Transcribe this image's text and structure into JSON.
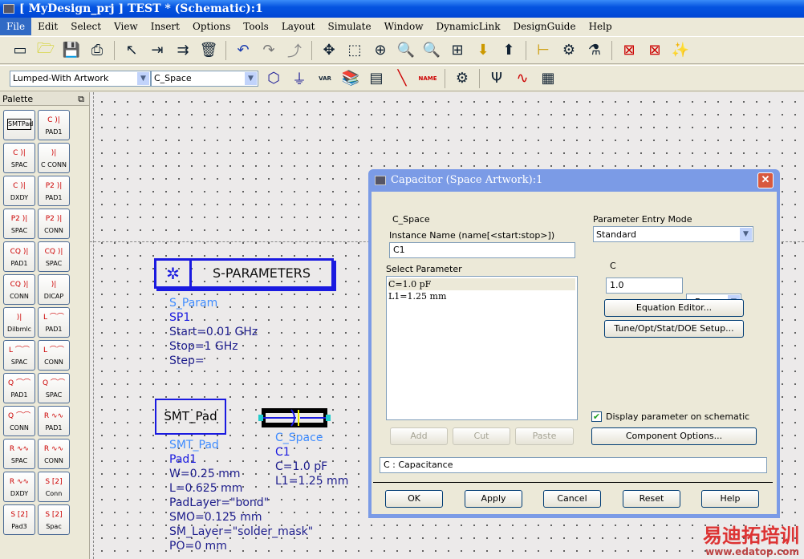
{
  "window": {
    "title": "[ MyDesign_prj ] TEST * (Schematic):1"
  },
  "menu": [
    "File",
    "Edit",
    "Select",
    "View",
    "Insert",
    "Options",
    "Tools",
    "Layout",
    "Simulate",
    "Window",
    "DynamicLink",
    "DesignGuide",
    "Help"
  ],
  "toolbar2": {
    "library": "Lumped-With Artwork",
    "component": "C_Space",
    "var_label": "VAR",
    "name_label": "NAME"
  },
  "palette": {
    "title": "Palette",
    "items": [
      {
        "sym": "SMTPad",
        "label": ""
      },
      {
        "sym": "C )|",
        "label": "PAD1"
      },
      {
        "sym": "C )|",
        "label": "SPAC"
      },
      {
        "sym": ")|",
        "label": "C CONN"
      },
      {
        "sym": "C )|",
        "label": "DXDY"
      },
      {
        "sym": "P2 )|",
        "label": "PAD1"
      },
      {
        "sym": "P2 )|",
        "label": "SPAC"
      },
      {
        "sym": "P2 )|",
        "label": "CONN"
      },
      {
        "sym": "CQ )|",
        "label": "PAD1"
      },
      {
        "sym": "CQ )|",
        "label": "SPAC"
      },
      {
        "sym": "CQ )|",
        "label": "CONN"
      },
      {
        "sym": ")|",
        "label": "DICAP"
      },
      {
        "sym": ")|",
        "label": "Dilbmlc"
      },
      {
        "sym": "L ⌒⌒",
        "label": "PAD1"
      },
      {
        "sym": "L ⌒⌒",
        "label": "SPAC"
      },
      {
        "sym": "L ⌒⌒",
        "label": "CONN"
      },
      {
        "sym": "Q ⌒⌒",
        "label": "PAD1"
      },
      {
        "sym": "Q ⌒⌒",
        "label": "SPAC"
      },
      {
        "sym": "Q ⌒⌒",
        "label": "CONN"
      },
      {
        "sym": "R ∿∿",
        "label": "PAD1"
      },
      {
        "sym": "R ∿∿",
        "label": "SPAC"
      },
      {
        "sym": "R ∿∿",
        "label": "CONN"
      },
      {
        "sym": "R ∿∿",
        "label": "DXDY"
      },
      {
        "sym": "S [2]",
        "label": "Conn"
      },
      {
        "sym": "S [2]",
        "label": "Pad3"
      },
      {
        "sym": "S [2]",
        "label": "Spac"
      }
    ]
  },
  "schematic": {
    "sparam": {
      "title": "S-PARAMETERS",
      "type": "S_Param",
      "name": "SP1",
      "lines": [
        "Start=0.01 GHz",
        "Stop=1 GHz",
        "Step="
      ]
    },
    "smtpad": {
      "title": "SMT_Pad",
      "type": "SMT_Pad",
      "name": "Pad1",
      "lines": [
        "W=0.25 mm",
        "L=0.625 mm",
        "PadLayer=\"bond\"",
        "SMO=0.125 mm",
        "SM_Layer=\"solder_mask\"",
        "PO=0 mm"
      ]
    },
    "cspace": {
      "type": "C_Space",
      "name": "C1",
      "lines": [
        "C=1.0 pF",
        "L1=1.25 mm"
      ]
    }
  },
  "dialog": {
    "title": "Capacitor (Space Artwork):1",
    "component": "C_Space",
    "instance_label": "Instance Name  (name[<start:stop>])",
    "instance_value": "C1",
    "select_label": "Select Parameter",
    "params": [
      "C=1.0 pF",
      "L1=1.25 mm"
    ],
    "mode_label": "Parameter Entry Mode",
    "mode_value": "Standard",
    "param_name": "C",
    "param_value": "1.0",
    "unit": "pF",
    "equation_editor": "Equation Editor...",
    "tune": "Tune/Opt/Stat/DOE Setup...",
    "add": "Add",
    "cut": "Cut",
    "paste": "Paste",
    "display_checkbox": "Display parameter on schematic",
    "display_checked": true,
    "component_options": "Component Options...",
    "description": "C : Capacitance",
    "ok": "OK",
    "apply": "Apply",
    "cancel": "Cancel",
    "reset": "Reset",
    "help": "Help"
  },
  "watermark": {
    "cn": "易迪拓培训",
    "url": "www.edatop.com"
  }
}
